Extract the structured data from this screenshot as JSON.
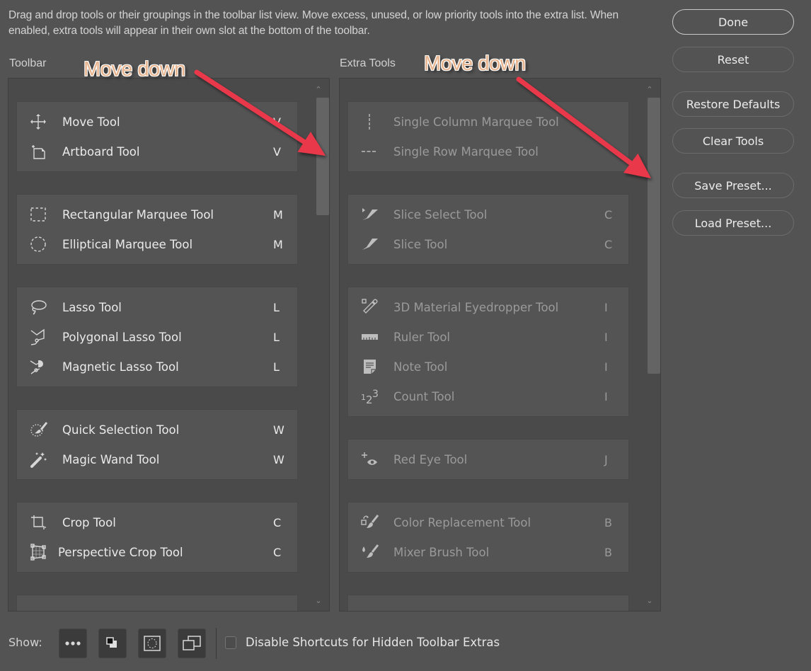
{
  "description": "Drag and drop tools or their groupings in the toolbar list view. Move excess, unused, or low priority tools into the extra list. When enabled, extra tools will appear in their own slot at the bottom of the toolbar.",
  "toolbar": {
    "label": "Toolbar",
    "scroll_position": 0.0,
    "groups": [
      {
        "tools": [
          {
            "name": "Move Tool",
            "key": "V",
            "icon": "move-icon"
          },
          {
            "name": "Artboard Tool",
            "key": "V",
            "icon": "artboard-icon"
          }
        ]
      },
      {
        "tools": [
          {
            "name": "Rectangular Marquee Tool",
            "key": "M",
            "icon": "rect-marquee-icon"
          },
          {
            "name": "Elliptical Marquee Tool",
            "key": "M",
            "icon": "ellipse-marquee-icon"
          }
        ]
      },
      {
        "tools": [
          {
            "name": "Lasso Tool",
            "key": "L",
            "icon": "lasso-icon"
          },
          {
            "name": "Polygonal Lasso Tool",
            "key": "L",
            "icon": "polygonal-lasso-icon"
          },
          {
            "name": "Magnetic Lasso Tool",
            "key": "L",
            "icon": "magnetic-lasso-icon"
          }
        ]
      },
      {
        "tools": [
          {
            "name": "Quick Selection Tool",
            "key": "W",
            "icon": "quick-selection-icon"
          },
          {
            "name": "Magic Wand Tool",
            "key": "W",
            "icon": "magic-wand-icon"
          }
        ]
      },
      {
        "tools": [
          {
            "name": "Crop Tool",
            "key": "C",
            "icon": "crop-icon"
          },
          {
            "name": "Perspective Crop Tool",
            "key": "C",
            "icon": "perspective-crop-icon"
          }
        ]
      }
    ]
  },
  "extra": {
    "label": "Extra Tools",
    "groups": [
      {
        "tools": [
          {
            "name": "Single Column Marquee Tool",
            "key": "",
            "icon": "single-column-marquee-icon"
          },
          {
            "name": "Single Row Marquee Tool",
            "key": "",
            "icon": "single-row-marquee-icon"
          }
        ]
      },
      {
        "tools": [
          {
            "name": "Slice Select Tool",
            "key": "C",
            "icon": "slice-select-icon"
          },
          {
            "name": "Slice Tool",
            "key": "C",
            "icon": "slice-icon"
          }
        ]
      },
      {
        "tools": [
          {
            "name": "3D Material Eyedropper Tool",
            "key": "I",
            "icon": "eyedropper-3d-icon"
          },
          {
            "name": "Ruler Tool",
            "key": "I",
            "icon": "ruler-icon"
          },
          {
            "name": "Note Tool",
            "key": "I",
            "icon": "note-icon"
          },
          {
            "name": "Count Tool",
            "key": "I",
            "icon": "count-icon"
          }
        ]
      },
      {
        "tools": [
          {
            "name": "Red Eye Tool",
            "key": "J",
            "icon": "red-eye-icon"
          }
        ]
      },
      {
        "tools": [
          {
            "name": "Color Replacement Tool",
            "key": "B",
            "icon": "color-replacement-icon"
          },
          {
            "name": "Mixer Brush Tool",
            "key": "B",
            "icon": "mixer-brush-icon"
          }
        ]
      }
    ]
  },
  "buttons": {
    "done": "Done",
    "reset": "Reset",
    "restore_defaults": "Restore Defaults",
    "clear_tools": "Clear Tools",
    "save_preset": "Save Preset...",
    "load_preset": "Load Preset..."
  },
  "footer": {
    "show_label": "Show:",
    "show_buttons": [
      "more-icon",
      "foreground-background-icon",
      "quick-mask-icon",
      "screen-mode-icon"
    ],
    "disable_shortcuts_label": "Disable Shortcuts for Hidden Toolbar Extras",
    "disable_shortcuts_checked": false
  },
  "annotations": {
    "left": "Move down",
    "right": "Move down",
    "arrow_color": "#e8384a"
  }
}
